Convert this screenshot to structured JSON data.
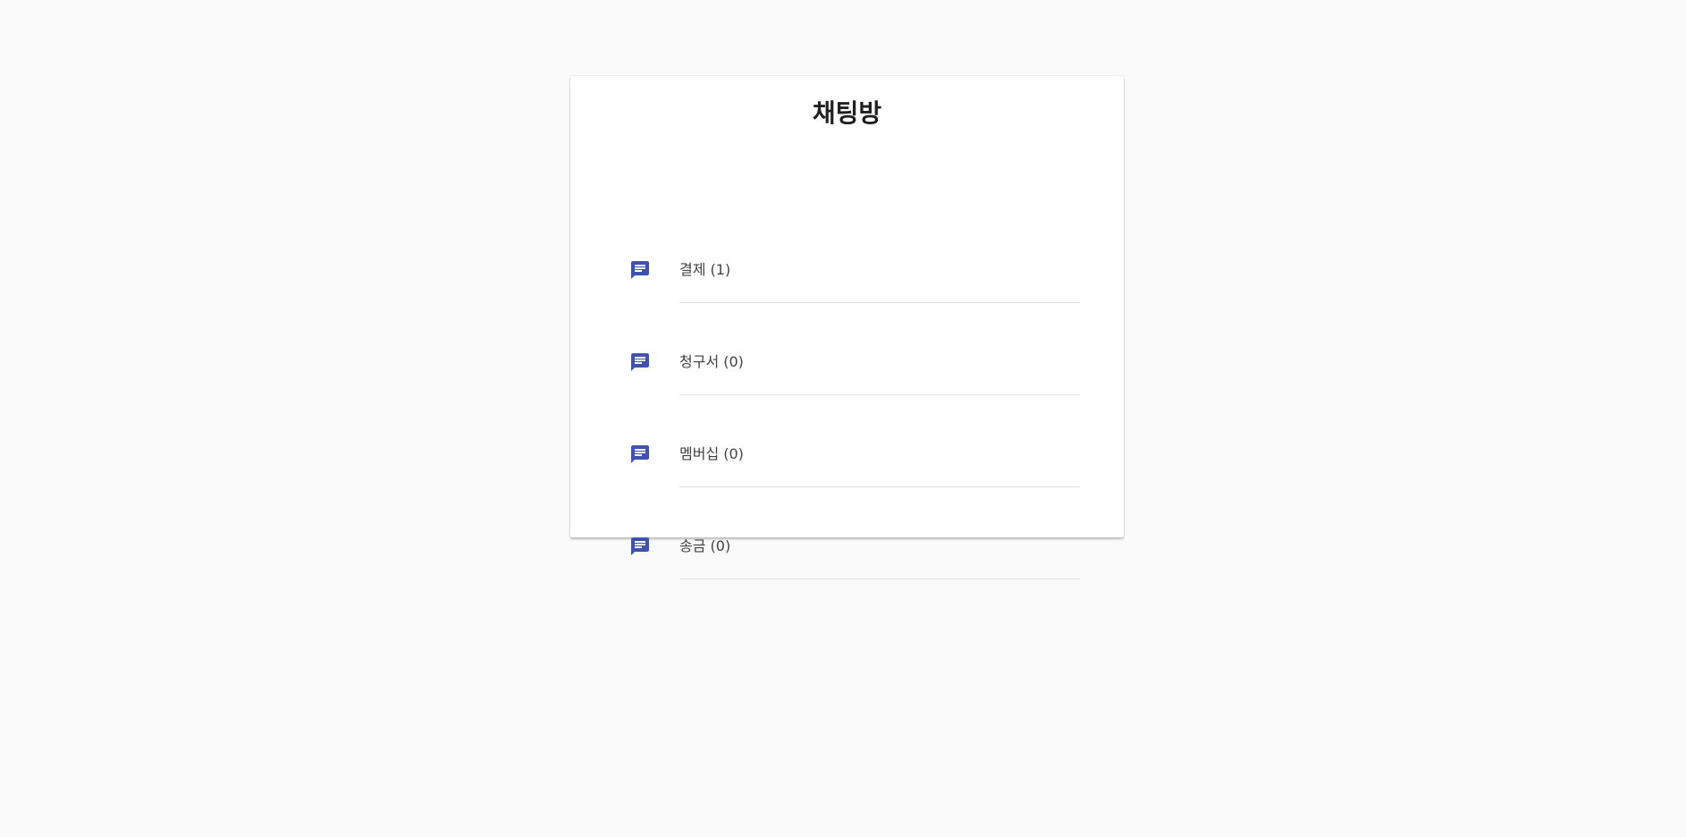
{
  "page": {
    "title": "채팅방"
  },
  "rooms": [
    {
      "label": "결제 (1)",
      "icon": "chat-icon"
    },
    {
      "label": "청구서 (0)",
      "icon": "chat-icon"
    },
    {
      "label": "멤버십 (0)",
      "icon": "chat-icon"
    },
    {
      "label": "송금 (0)",
      "icon": "chat-icon"
    }
  ],
  "colors": {
    "icon": "#3f51b5",
    "background": "#fafafa",
    "card": "#ffffff",
    "divider": "#e0e0e0",
    "text": "#424242"
  }
}
